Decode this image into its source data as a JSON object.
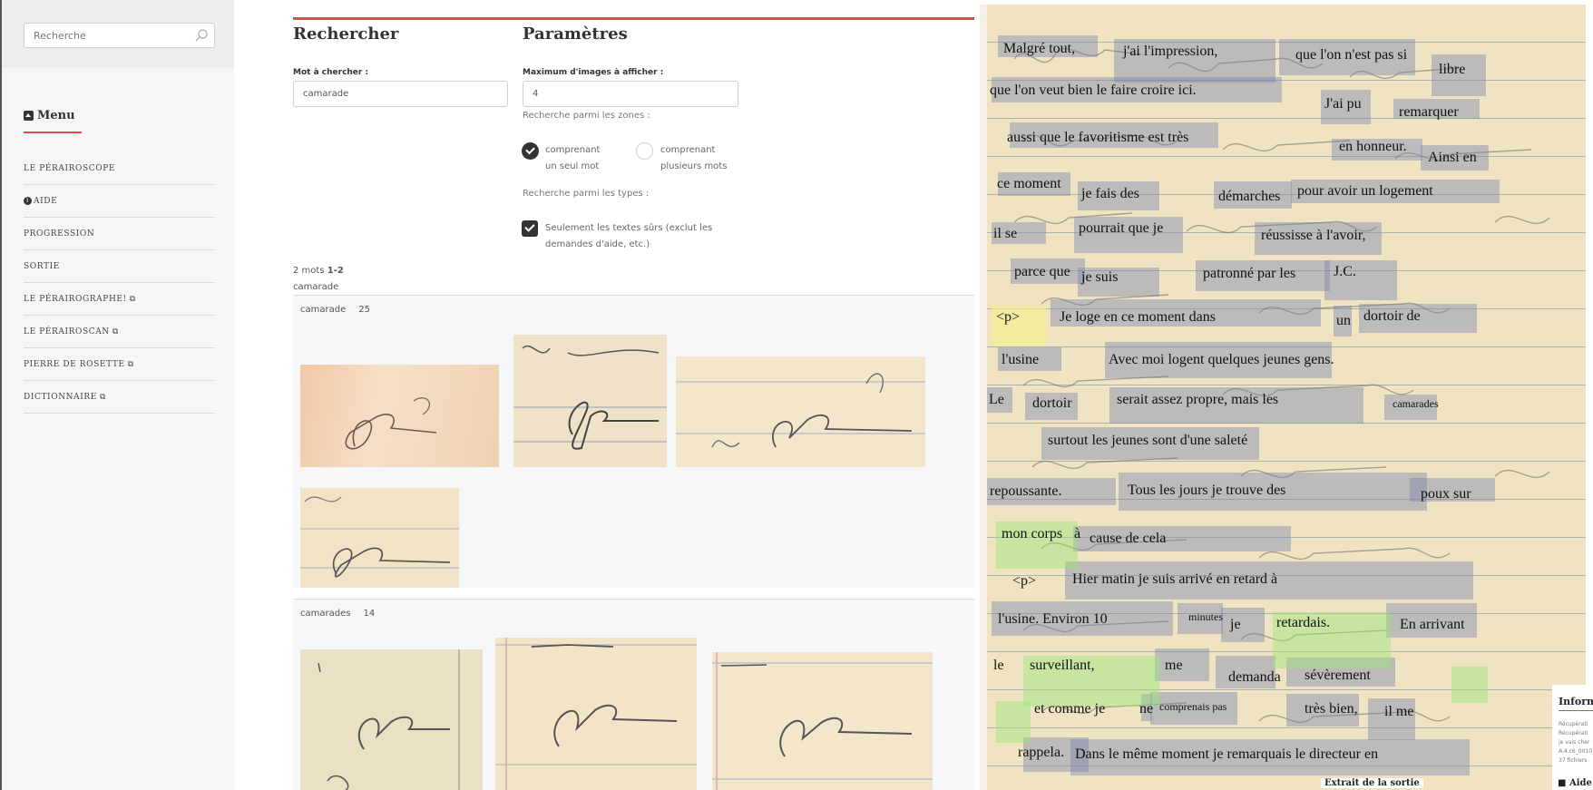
{
  "sidebar": {
    "search_placeholder": "Recherche",
    "menu_title": "Menu",
    "items": [
      {
        "label": "LE PÉRAIROSCOPE",
        "external": false,
        "info": false
      },
      {
        "label": "AIDE",
        "external": false,
        "info": true
      },
      {
        "label": "PROGRESSION",
        "external": false,
        "info": false
      },
      {
        "label": "SORTIE",
        "external": false,
        "info": false
      },
      {
        "label": "LE PÉRAIROGRAPHE!",
        "external": true,
        "info": false
      },
      {
        "label": "LE PÉRAIROSCAN",
        "external": true,
        "info": false
      },
      {
        "label": "PIERRE DE ROSETTE",
        "external": true,
        "info": false
      },
      {
        "label": "DICTIONNAIRE",
        "external": true,
        "info": false
      }
    ]
  },
  "search_form": {
    "title": "Rechercher",
    "word_label": "Mot à chercher :",
    "word_value": "camarade"
  },
  "params": {
    "title": "Paramètres",
    "max_label": "Maximum d'images à afficher :",
    "max_value": "4",
    "zones_label": "Recherche parmi les zones :",
    "zone_single_line1": "comprenant",
    "zone_single_line2": "un seul mot",
    "zone_multi_line1": "comprenant",
    "zone_multi_line2": "plusieurs mots",
    "types_label": "Recherche parmi les types :",
    "safe_line1": "Seulement les textes sûrs (exclut les",
    "safe_line2": "demandes d'aide, etc.)"
  },
  "results": {
    "count_text": "2 mots ",
    "range_text": "1-2",
    "query_echo": "camarade",
    "groups": [
      {
        "word": "camarade",
        "count": "25"
      },
      {
        "word": "camarades",
        "count": "14"
      }
    ]
  },
  "document": {
    "words": [
      "Malgré tout,",
      "j'ai l'impression,",
      "que l'on n'est pas si",
      "libre",
      "que l'on veut bien le faire croire ici.",
      "J'ai pu",
      "remarquer",
      "aussi que le favoritisme est très",
      "en honneur.",
      "Ainsi en",
      "ce moment",
      "je fais des",
      "démarches",
      "pour avoir un logement",
      "il se",
      "pourrait que je",
      "réussisse à l'avoir,",
      "parce que",
      "je suis",
      "patronné par les",
      "J.C.",
      "<p>",
      "Je loge en ce moment dans",
      "un",
      "dortoir de",
      "l'usine",
      "Avec moi logent quelques jeunes gens.",
      "Le",
      "dortoir",
      "serait assez propre, mais les",
      "camarades",
      "surtout les jeunes sont d'une saleté",
      "repoussante.",
      "Tous les jours je trouve des",
      "poux sur",
      "mon corps",
      "à",
      "cause de cela",
      "<p>",
      "Hier matin je suis arrivé en retard à",
      "l'usine. Environ 10",
      "minutes",
      "je",
      "retardais.",
      "En arrivant",
      "le",
      "surveillant,",
      "me",
      "demanda",
      "sévèrement",
      "et comme je",
      "ne",
      "comprenais pas",
      "très bien,",
      "il me",
      "rappela.",
      "Dans le même moment je remarquais le directeur en"
    ],
    "info_title": "Inform",
    "info_lines": [
      "Récupérati",
      "Récupérati",
      "je vais cher",
      "A.4.c6_0010",
      "37 fichiers"
    ],
    "aide_label": "Aide",
    "extrait_label": "Extrait de la sortie"
  }
}
